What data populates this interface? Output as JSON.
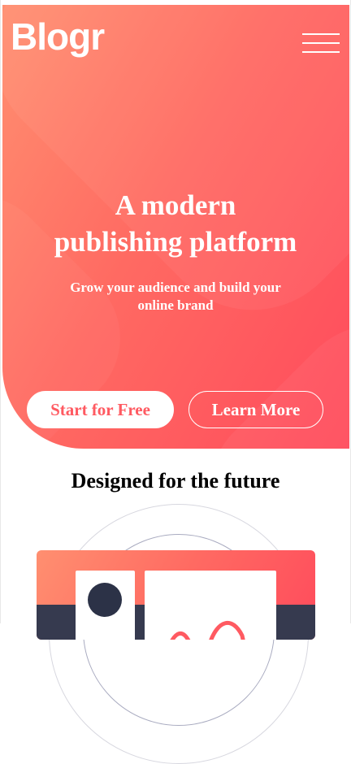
{
  "header": {
    "logo_text": "Blogr",
    "menu_icon": "hamburger-menu-icon"
  },
  "hero": {
    "headline_lines": [
      "A modern",
      "publishing platform"
    ],
    "subheading_lines": [
      "Grow your audience and build your",
      "online brand"
    ],
    "primary_button_label": "Start for Free",
    "secondary_button_label": "Learn More"
  },
  "features": {
    "title": "Designed for the future"
  },
  "colors": {
    "gradient_start": "#ff8f70",
    "gradient_end": "#ff4b5c",
    "primary_button_text": "#ff5a61",
    "illustration_dark": "#363a4f"
  }
}
